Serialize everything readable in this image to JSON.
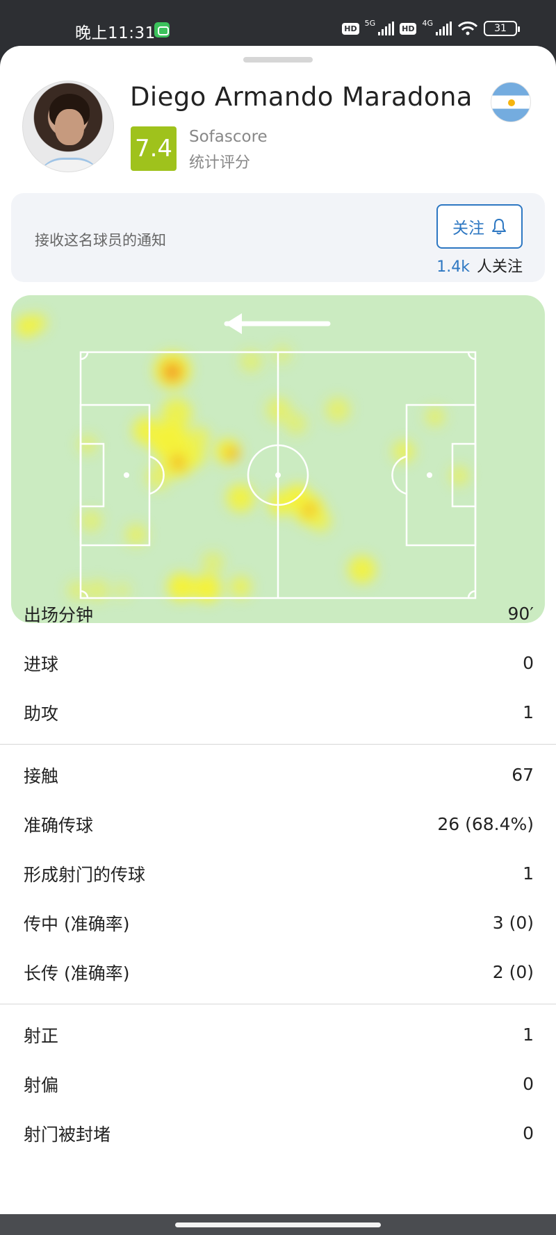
{
  "status_bar": {
    "time": "晚上11:31",
    "hd1": "HD",
    "net1": "5G",
    "hd2": "HD",
    "net2": "4G",
    "battery": "31"
  },
  "player": {
    "name": "Diego Armando Maradona",
    "rating": "7.4",
    "rating_source": "Sofascore",
    "rating_caption": "统计评分",
    "flag_icon": "argentina-flag"
  },
  "notify": {
    "text": "接收这名球员的通知",
    "follow_label": "关注",
    "followers_count": "1.4k",
    "followers_suffix": "人关注"
  },
  "heatmap": {
    "direction": "left",
    "colors": {
      "pitch": "#cbebc1",
      "low": "#f4f23a",
      "high": "#f28a2a"
    }
  },
  "stats": {
    "group1": [
      {
        "label": "出场分钟",
        "value": "90′"
      },
      {
        "label": "进球",
        "value": "0"
      },
      {
        "label": "助攻",
        "value": "1"
      }
    ],
    "group2": [
      {
        "label": "接触",
        "value": "67"
      },
      {
        "label": "准确传球",
        "value": "26 (68.4%)"
      },
      {
        "label": "形成射门的传球",
        "value": "1"
      },
      {
        "label": "传中 (准确率)",
        "value": "3 (0)"
      },
      {
        "label": "长传 (准确率)",
        "value": "2 (0)"
      }
    ],
    "group3": [
      {
        "label": "射正",
        "value": "1"
      },
      {
        "label": "射偏",
        "value": "0"
      },
      {
        "label": "射门被封堵",
        "value": "0"
      }
    ]
  },
  "colors": {
    "accent": "#2d77c2",
    "rating_bg": "#9fc21c"
  }
}
